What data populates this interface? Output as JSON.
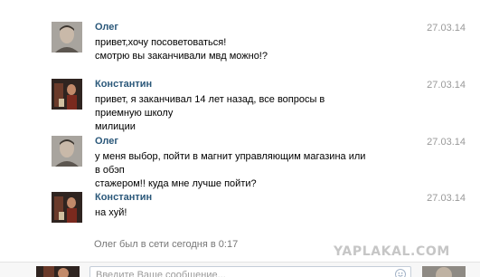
{
  "messages": [
    {
      "sender": "Олег",
      "date": "27.03.14",
      "avatar": "oleg-avatar",
      "text": "привет,хочу посоветоваться!\nсмотрю вы заканчивали мвд можно!?"
    },
    {
      "sender": "Константин",
      "date": "27.03.14",
      "avatar": "konstantin-avatar",
      "text": "привет, я заканчивал 14 лет назад, все вопросы в приемную школу\nмилиции"
    },
    {
      "sender": "Олег",
      "date": "27.03.14",
      "avatar": "oleg-avatar",
      "text": "у меня выбор, пойти в магнит управляющим магазина или в обэп\nстажером!! куда мне лучше пойти?"
    },
    {
      "sender": "Константин",
      "date": "27.03.14",
      "avatar": "konstantin-avatar",
      "text": "на хуй!"
    }
  ],
  "status": "Олег был в сети сегодня в 0:17",
  "watermark": "YAPLAKAL.COM",
  "composer": {
    "placeholder": "Введите Ваше сообщение..."
  },
  "icons": {
    "emoji": "smile-icon"
  }
}
